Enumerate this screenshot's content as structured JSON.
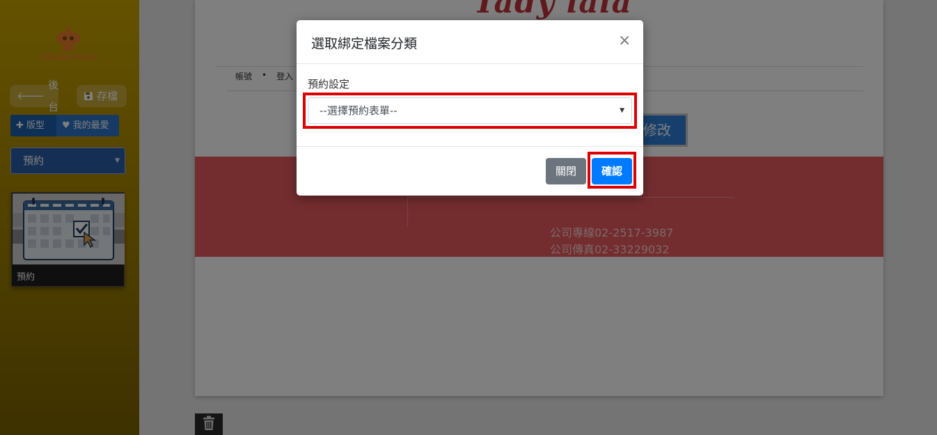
{
  "sidebar": {
    "logo_text": "GOLDENMAN",
    "back_label": "後台",
    "save_label": "存檔",
    "tabs": [
      {
        "label": "版型",
        "icon": "puzzle-icon"
      },
      {
        "label": "我的最愛",
        "icon": "heart-icon"
      }
    ],
    "category_select": {
      "value": "預約"
    },
    "thumbnail": {
      "label": "預約",
      "icon": "calendar-check-icon"
    }
  },
  "canvas": {
    "brand": "Tady lala",
    "breadcrumbs": [
      "帳號",
      "登入"
    ],
    "modify_label": "修改",
    "contact": {
      "phone": "公司專線02-2517-3987",
      "fax": "公司傳真02-33229032"
    }
  },
  "modal": {
    "title": "選取綁定檔案分類",
    "close_symbol": "×",
    "field_label": "預約設定",
    "select_value": "--選擇預約表單--",
    "close_button": "關閉",
    "confirm_button": "確認"
  },
  "colors": {
    "sidebar_gold": "#b08e00",
    "primary": "#007bff",
    "secondary": "#6c757d",
    "highlight": "#dd0000",
    "band_red": "#e85a5e"
  }
}
